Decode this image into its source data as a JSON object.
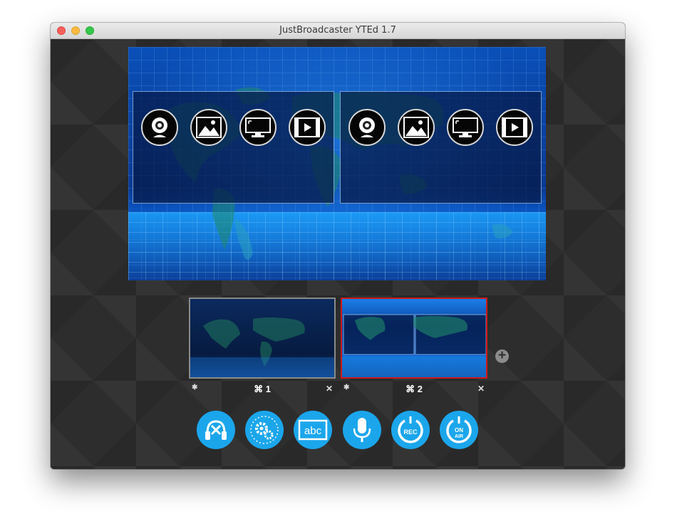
{
  "window": {
    "title": "JustBroadcaster YTEd 1.7"
  },
  "preview": {
    "slots": [
      {
        "sources": [
          "webcam-icon",
          "image-icon",
          "screen-icon",
          "video-icon"
        ]
      },
      {
        "sources": [
          "webcam-icon",
          "image-icon",
          "screen-icon",
          "video-icon"
        ]
      }
    ]
  },
  "scenes": [
    {
      "label": "⌘ 1",
      "selected": false
    },
    {
      "label": "⌘ 2",
      "selected": true
    }
  ],
  "toolbar": {
    "buttons": [
      "mute-audio-icon",
      "settings-icon",
      "text-abc-icon",
      "microphone-icon",
      "record-icon",
      "on-air-icon"
    ],
    "text_label": "abc",
    "rec_label": "REC",
    "on_air_label_1": "ON",
    "on_air_label_2": "AIR"
  },
  "colors": {
    "accent": "#1ba6ec",
    "selected_scene_border": "#d01818"
  }
}
